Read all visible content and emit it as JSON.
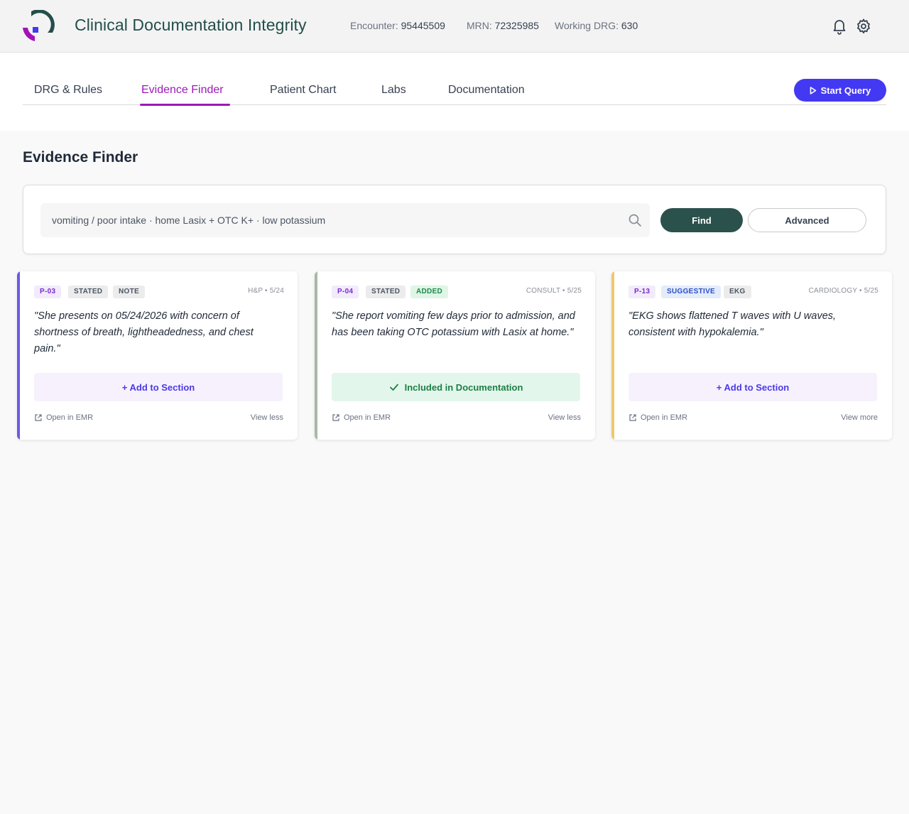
{
  "header": {
    "app_title": "Clinical Documentation Integrity",
    "encounter_label": "Encounter:",
    "encounter_value": "95445509",
    "mrn_label": "MRN:",
    "mrn_value": "72325985",
    "drg_label": "Working DRG:",
    "drg_value": "630",
    "icons": [
      "bell-icon",
      "gear-icon"
    ]
  },
  "tabs": [
    {
      "label": "DRG & Rules",
      "active": false
    },
    {
      "label": "Evidence Finder",
      "active": true
    },
    {
      "label": "Patient Chart",
      "active": false
    },
    {
      "label": "Labs",
      "active": false
    },
    {
      "label": "Documentation",
      "active": false
    }
  ],
  "start_query_label": "Start Query",
  "page_title": "Evidence Finder",
  "search": {
    "value": "vomiting / poor intake · home Lasix + OTC K+ · low potassium",
    "find_label": "Find",
    "advanced_label": "Advanced"
  },
  "cards": [
    {
      "id": "P-03",
      "tags": [
        "STATED",
        "NOTE"
      ],
      "source": "H&P • 5/24",
      "quote": "\"She presents on 05/24/2026 with concern of shortness of breath, lightheadedness, and chest pain.\"",
      "action_label": "+ Add to Section",
      "open_label": "Open in EMR",
      "view_label": "View less",
      "accent": "#6a5ae8"
    },
    {
      "id": "P-04",
      "tags": [
        "STATED",
        "ADDED"
      ],
      "source": "CONSULT • 5/25",
      "quote": "\"She report vomiting few days prior to admission, and has been taking OTC potassium with Lasix at home.\"",
      "action_label": "Included in Documentation",
      "open_label": "Open in EMR",
      "view_label": "View less",
      "accent": "#a9b9a4"
    },
    {
      "id": "P-13",
      "tags": [
        "SUGGESTIVE",
        "EKG"
      ],
      "source": "CARDIOLOGY • 5/25",
      "quote": "\"EKG shows flattened T waves with U waves, consistent with hypokalemia.\"",
      "action_label": "+ Add to Section",
      "open_label": "Open in EMR",
      "view_label": "View more",
      "accent": "#f1c76a"
    }
  ],
  "colors": {
    "brand_dark": "#234e4a",
    "active_tab": "#9b1ab6",
    "primary_button": "#4339f2",
    "find_button": "#2b514c"
  }
}
